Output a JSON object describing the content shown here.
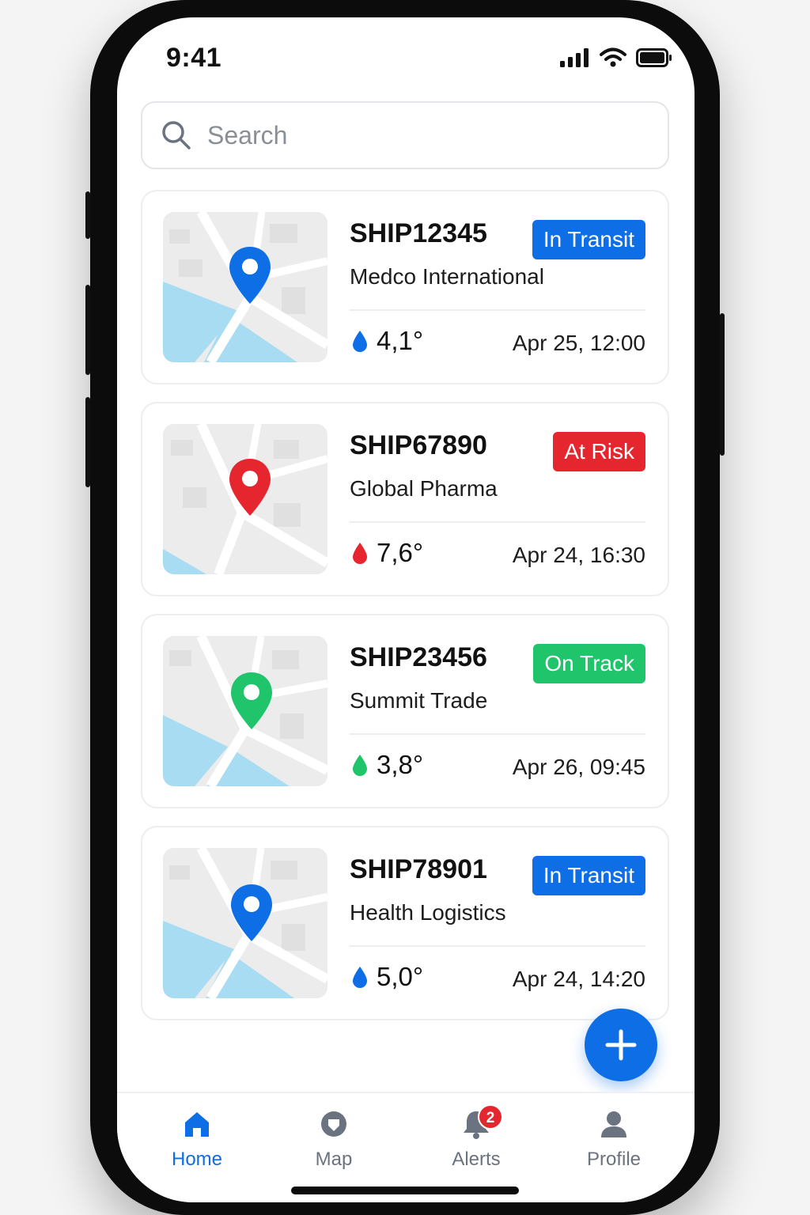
{
  "status_bar": {
    "time": "9:41"
  },
  "search": {
    "placeholder": "Search"
  },
  "shipments": [
    {
      "id": "SHIP12345",
      "company": "Medco International",
      "status": "In Transit",
      "status_color": "#0d6ee6",
      "temperature": "4,1°",
      "date": "Apr 25, 12:00",
      "pin_color": "#0d6ee6"
    },
    {
      "id": "SHIP67890",
      "company": "Global Pharma",
      "status": "At Risk",
      "status_color": "#e5262f",
      "temperature": "7,6°",
      "date": "Apr 24, 16:30",
      "pin_color": "#e5262f"
    },
    {
      "id": "SHIP23456",
      "company": "Summit Trade",
      "status": "On Track",
      "status_color": "#1fc46b",
      "temperature": "3,8°",
      "date": "Apr 26, 09:45",
      "pin_color": "#1fc46b"
    },
    {
      "id": "SHIP78901",
      "company": "Health Logistics",
      "status": "In Transit",
      "status_color": "#0d6ee6",
      "temperature": "5,0°",
      "date": "Apr 24, 14:20",
      "pin_color": "#0d6ee6"
    }
  ],
  "fab": {
    "icon": "plus-icon",
    "label": "+"
  },
  "tab_bar": {
    "tabs": [
      {
        "label": "Home",
        "icon": "home-icon",
        "active": true
      },
      {
        "label": "Map",
        "icon": "map-icon",
        "active": false
      },
      {
        "label": "Alerts",
        "icon": "bell-icon",
        "active": false,
        "badge": "2"
      },
      {
        "label": "Profile",
        "icon": "profile-icon",
        "active": false
      }
    ]
  },
  "colors": {
    "accent": "#0d6ee6",
    "danger": "#e5262f",
    "success": "#1fc46b",
    "water": "#a8dcf2"
  }
}
